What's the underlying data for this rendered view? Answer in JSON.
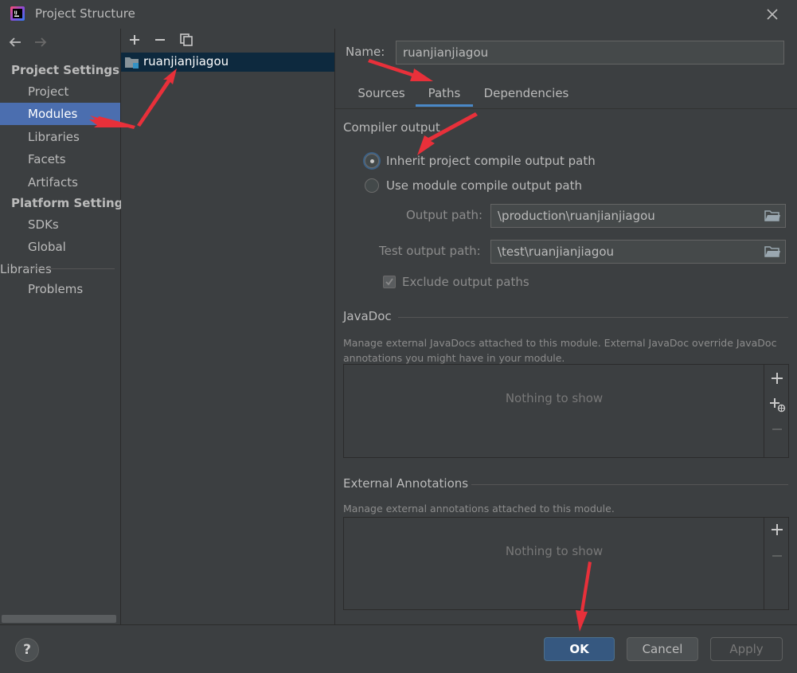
{
  "window": {
    "title": "Project Structure",
    "close_label": "×"
  },
  "sidebar": {
    "project_settings_header": "Project Settings",
    "platform_settings_header": "Platform Settings",
    "items": [
      {
        "label": "Project"
      },
      {
        "label": "Modules",
        "selected": true
      },
      {
        "label": "Libraries"
      },
      {
        "label": "Facets"
      },
      {
        "label": "Artifacts"
      },
      {
        "label": "SDKs"
      },
      {
        "label": "Global Libraries"
      },
      {
        "label": "Problems"
      }
    ]
  },
  "modules": {
    "items": [
      {
        "label": "ruanjianjiagou",
        "selected": true
      }
    ]
  },
  "detail": {
    "name_label": "Name:",
    "name_value": "ruanjianjiagou",
    "tabs": [
      {
        "label": "Sources"
      },
      {
        "label": "Paths",
        "active": true
      },
      {
        "label": "Dependencies"
      }
    ],
    "compiler_output": {
      "header": "Compiler output",
      "inherit_option": "Inherit project compile output path",
      "module_option": "Use module compile output path",
      "selected": "inherit",
      "output_path_label": "Output path:",
      "output_path_value": "\\production\\ruanjianjiagou",
      "test_output_path_label": "Test output path:",
      "test_output_path_value": "\\test\\ruanjianjiagou",
      "exclude_label": "Exclude output paths",
      "exclude_checked": true
    },
    "javadoc": {
      "header": "JavaDoc",
      "description": "Manage external JavaDocs attached to this module. External JavaDoc override JavaDoc annotations you might have in your module.",
      "empty_text": "Nothing to show"
    },
    "external_annotations": {
      "header": "External Annotations",
      "description": "Manage external annotations attached to this module.",
      "empty_text": "Nothing to show"
    }
  },
  "footer": {
    "help_label": "?",
    "ok_label": "OK",
    "cancel_label": "Cancel",
    "apply_label": "Apply"
  },
  "colors": {
    "background": "#3c3f41",
    "selection": "#4b6eaf",
    "tab_underline": "#4a88c7",
    "annotation_arrow": "#e8303a"
  }
}
